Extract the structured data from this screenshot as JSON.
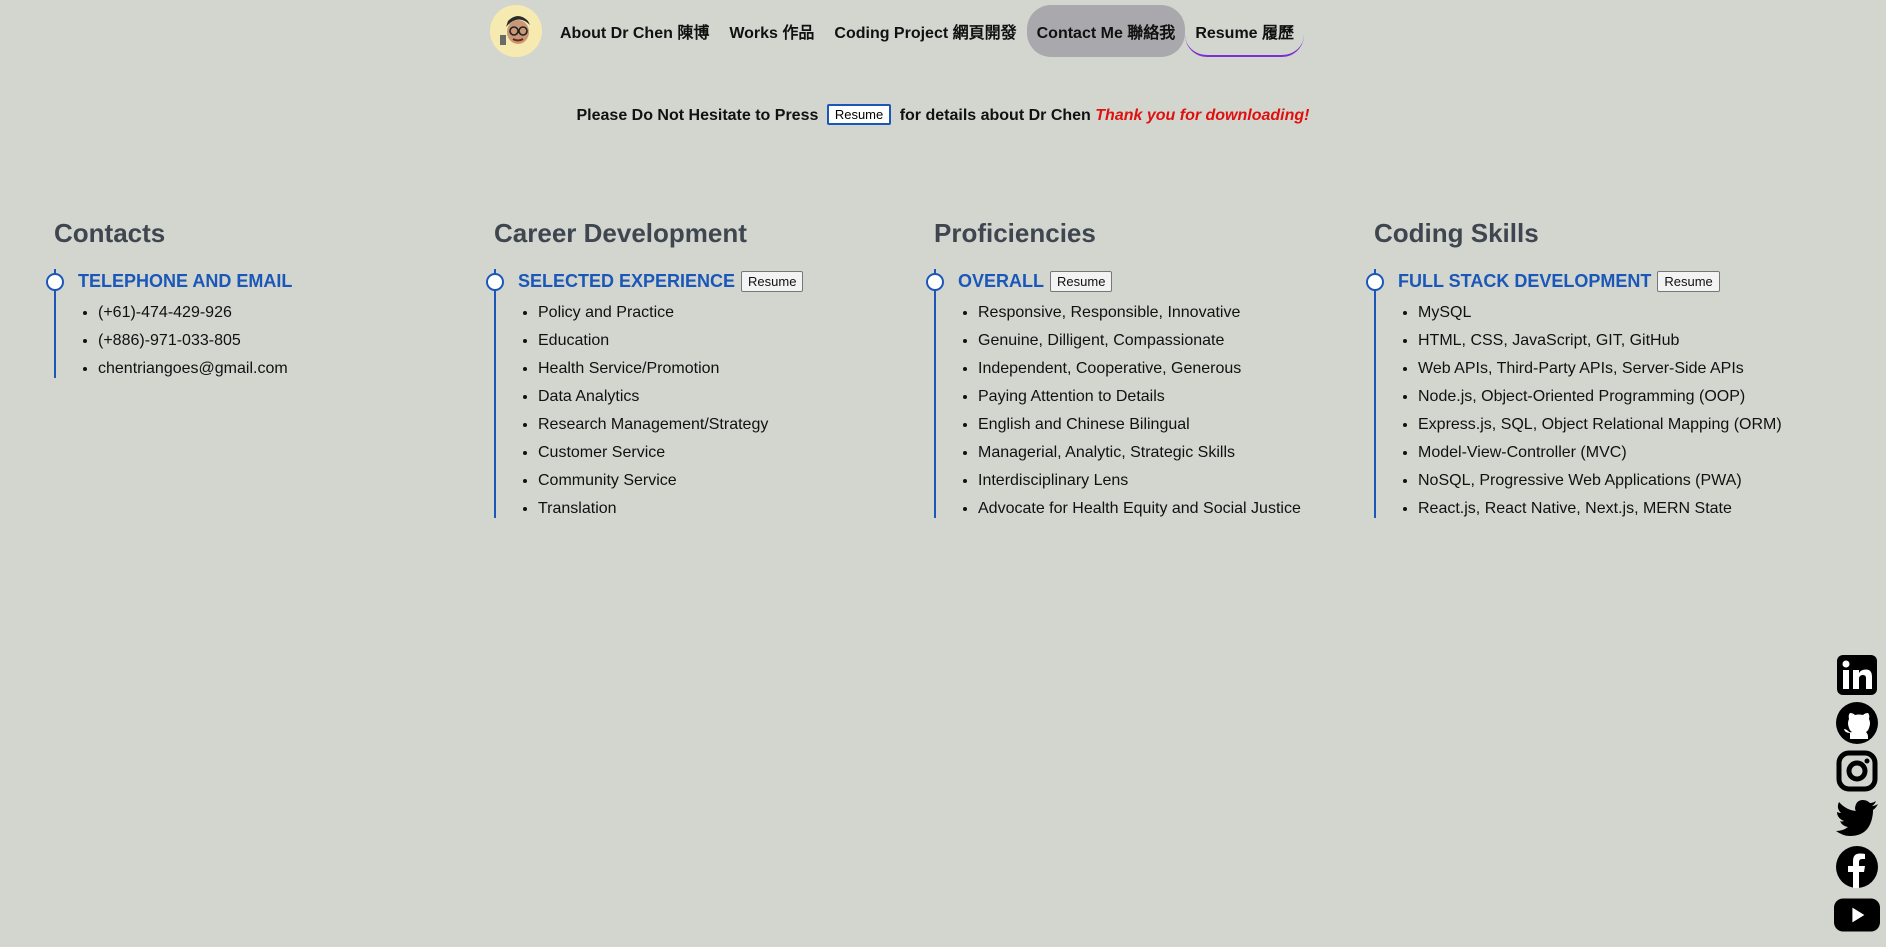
{
  "nav": {
    "items": [
      {
        "label": "About Dr Chen 陳博"
      },
      {
        "label": "Works 作品"
      },
      {
        "label": "Coding Project 網頁開發"
      },
      {
        "label": "Contact Me 聯絡我"
      },
      {
        "label": "Resume 履歷"
      }
    ]
  },
  "prompt": {
    "before": "Please Do Not Hesitate to Press",
    "button": "Resume",
    "after": "for details about Dr Chen",
    "thanks": "Thank you for downloading!"
  },
  "columns": [
    {
      "title": "Contacts",
      "section": "TELEPHONE AND EMAIL",
      "button": "",
      "items": [
        "(+61)-474-429-926",
        "(+886)-971-033-805",
        "chentriangoes@gmail.com"
      ]
    },
    {
      "title": "Career Development",
      "section": "SELECTED EXPERIENCE",
      "button": "Resume",
      "items": [
        "Policy and Practice",
        "Education",
        "Health Service/Promotion",
        "Data Analytics",
        "Research Management/Strategy",
        "Customer Service",
        "Community Service",
        "Translation"
      ]
    },
    {
      "title": "Proficiencies",
      "section": "OVERALL",
      "button": "Resume",
      "items": [
        "Responsive, Responsible, Innovative",
        "Genuine, Dilligent, Compassionate",
        "Independent, Cooperative, Generous",
        "Paying Attention to Details",
        "English and Chinese Bilingual",
        "Managerial, Analytic, Strategic Skills",
        "Interdisciplinary Lens",
        "Advocate for Health Equity and Social Justice"
      ]
    },
    {
      "title": "Coding Skills",
      "section": "FULL STACK DEVELOPMENT",
      "button": "Resume",
      "items": [
        "MySQL",
        "HTML, CSS, JavaScript, GIT, GitHub",
        "Web APIs, Third-Party APIs, Server-Side APIs",
        "Node.js, Object-Oriented Programming (OOP)",
        "Express.js, SQL, Object Relational Mapping (ORM)",
        "Model-View-Controller (MVC)",
        "NoSQL, Progressive Web Applications (PWA)",
        "React.js, React Native, Next.js, MERN State"
      ]
    }
  ],
  "social": [
    "linkedin-icon",
    "github-icon",
    "instagram-icon",
    "twitter-icon",
    "facebook-icon",
    "youtube-icon"
  ],
  "colors": {
    "background": "#d3d6cf",
    "accent": "#1a57b8",
    "thanks": "#e01010",
    "heading": "#3f4650"
  }
}
